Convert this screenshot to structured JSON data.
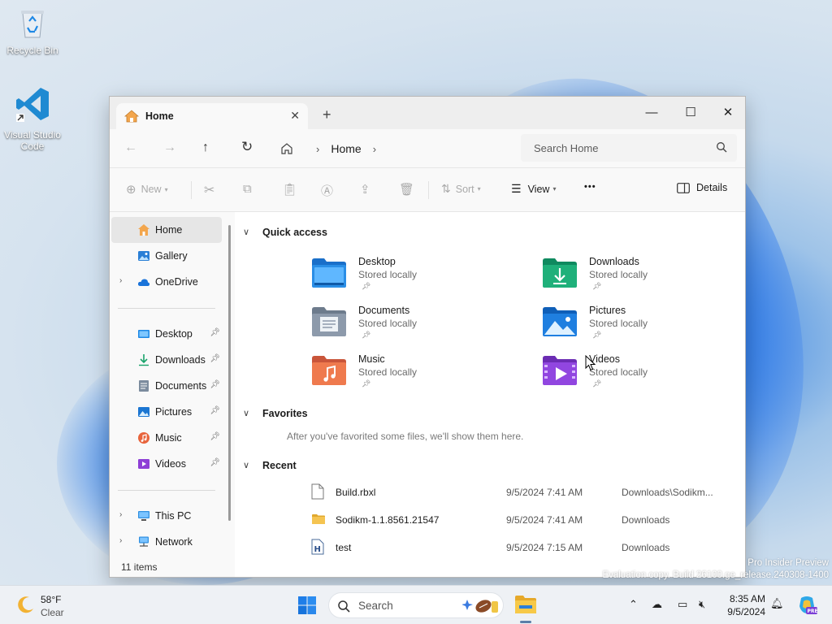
{
  "desktop": {
    "icons": [
      {
        "label": "Recycle Bin"
      },
      {
        "label": "Visual Studio Code"
      }
    ],
    "watermark_line1": "Pro Insider Preview",
    "watermark_line2": "Evaluation copy. Build 26100.ge_release.240308-1400"
  },
  "window": {
    "tab_title": "Home",
    "new_tab_symbol": "+",
    "controls": {
      "minimize": "—",
      "maximize": "☐",
      "close": "✕"
    }
  },
  "address": {
    "breadcrumb": "Home",
    "search_placeholder": "Search Home"
  },
  "commandbar": {
    "new_label": "New",
    "sort_label": "Sort",
    "view_label": "View",
    "more_label": "•••",
    "details_label": "Details"
  },
  "sidebar": {
    "top": [
      {
        "label": "Home"
      },
      {
        "label": "Gallery"
      },
      {
        "label": "OneDrive"
      }
    ],
    "pinned": [
      {
        "label": "Desktop"
      },
      {
        "label": "Downloads"
      },
      {
        "label": "Documents"
      },
      {
        "label": "Pictures"
      },
      {
        "label": "Music"
      },
      {
        "label": "Videos"
      }
    ],
    "bottom": [
      {
        "label": "This PC"
      },
      {
        "label": "Network"
      }
    ],
    "status": "11 items"
  },
  "content": {
    "quick_access_title": "Quick access",
    "quick_access": [
      {
        "name": "Desktop",
        "sub": "Stored locally"
      },
      {
        "name": "Downloads",
        "sub": "Stored locally"
      },
      {
        "name": "Documents",
        "sub": "Stored locally"
      },
      {
        "name": "Pictures",
        "sub": "Stored locally"
      },
      {
        "name": "Music",
        "sub": "Stored locally"
      },
      {
        "name": "Videos",
        "sub": "Stored locally"
      }
    ],
    "favorites_title": "Favorites",
    "favorites_empty": "After you've favorited some files, we'll show them here.",
    "recent_title": "Recent",
    "recent": [
      {
        "name": "Build.rbxl",
        "date": "9/5/2024 7:41 AM",
        "location": "Downloads\\Sodikm..."
      },
      {
        "name": "Sodikm-1.1.8561.21547",
        "date": "9/5/2024 7:41 AM",
        "location": "Downloads"
      },
      {
        "name": "test",
        "date": "9/5/2024 7:15 AM",
        "location": "Downloads"
      }
    ]
  },
  "taskbar": {
    "weather_temp": "58°F",
    "weather_cond": "Clear",
    "search_label": "Search",
    "time": "8:35 AM",
    "date": "9/5/2024"
  }
}
